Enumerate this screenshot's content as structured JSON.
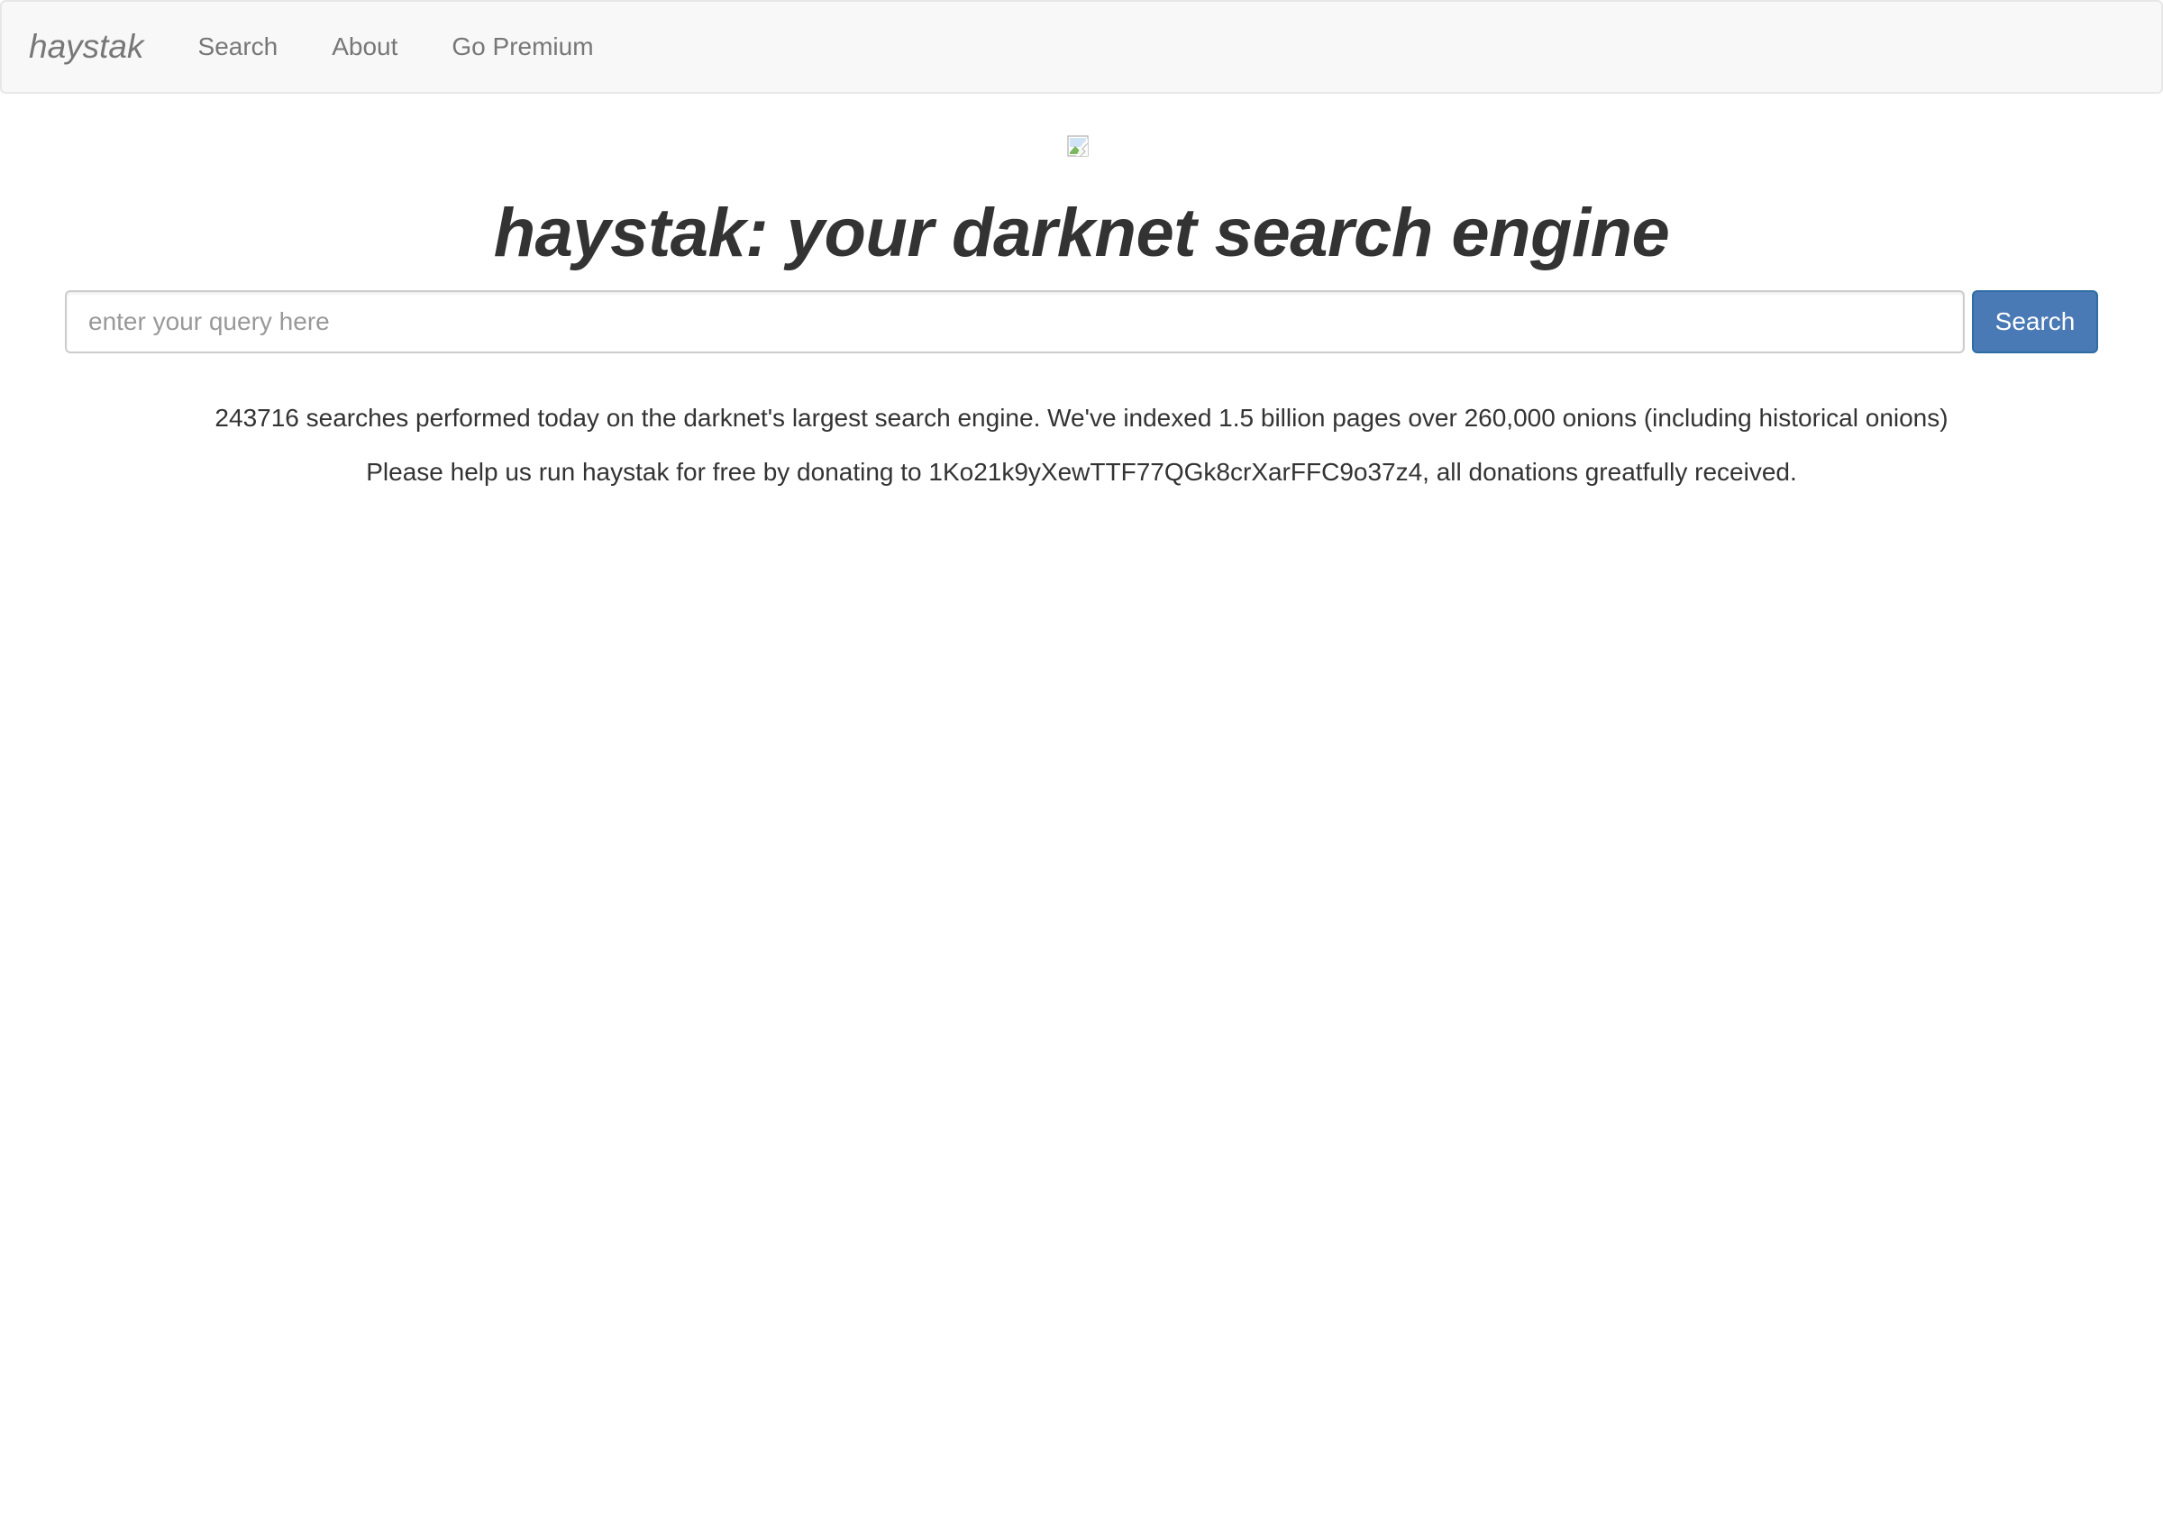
{
  "navbar": {
    "brand": "haystak",
    "links": [
      {
        "label": "Search"
      },
      {
        "label": "About"
      },
      {
        "label": "Go Premium"
      }
    ]
  },
  "main": {
    "headline": "haystak: your darknet search engine",
    "search": {
      "placeholder": "enter your query here",
      "value": "",
      "button_label": "Search"
    },
    "stats_text": "243716 searches performed today on the darknet's largest search engine. We've indexed 1.5 billion pages over 260,000 onions (including historical onions)",
    "donate_text": "Please help us run haystak for free by donating to 1Ko21k9yXewTTF77QGk8crXarFFC9o37z4, all donations greatfully received."
  },
  "colors": {
    "navbar_bg": "#f8f8f8",
    "nav_text": "#777777",
    "primary_button": "#4a7ab5",
    "body_text": "#333333"
  },
  "icons": {
    "logo": "broken-image-icon"
  }
}
